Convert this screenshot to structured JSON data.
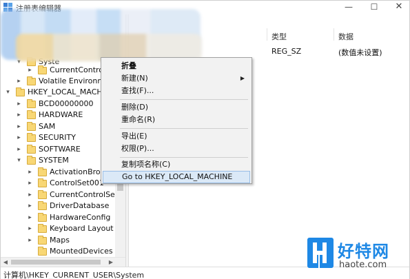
{
  "window": {
    "title": "注册表编辑器",
    "controls": {
      "minimize": "—",
      "maximize": "☐",
      "close": "✕"
    }
  },
  "tree": {
    "items": [
      {
        "label": "Syste",
        "chevron": "▾"
      },
      {
        "label": "CurrentControlS",
        "chevron": "▸"
      },
      {
        "label": "Volatile Environme",
        "chevron": "▸"
      },
      {
        "label": "HKEY_LOCAL_MACHIN",
        "chevron": "▾"
      },
      {
        "label": "BCD00000000",
        "chevron": "▸"
      },
      {
        "label": "HARDWARE",
        "chevron": "▸"
      },
      {
        "label": "SAM",
        "chevron": "▸"
      },
      {
        "label": "SECURITY",
        "chevron": "▸"
      },
      {
        "label": "SOFTWARE",
        "chevron": "▸"
      },
      {
        "label": "SYSTEM",
        "chevron": "▾"
      },
      {
        "label": "ActivationBroke",
        "chevron": "▸"
      },
      {
        "label": "ControlSet001",
        "chevron": "▸"
      },
      {
        "label": "CurrentControlSet",
        "chevron": "▸"
      },
      {
        "label": "DriverDatabase",
        "chevron": "▸"
      },
      {
        "label": "HardwareConfig",
        "chevron": "▸"
      },
      {
        "label": "Keyboard Layout",
        "chevron": "▸"
      },
      {
        "label": "Maps",
        "chevron": "▸"
      },
      {
        "label": "MountedDevices",
        "chevron": ""
      }
    ]
  },
  "list": {
    "columns": {
      "type": "类型",
      "data": "数据"
    },
    "rows": [
      {
        "type": "REG_SZ",
        "data": "(数值未设置)"
      }
    ]
  },
  "context_menu": {
    "items": {
      "collapse": "折叠",
      "new": "新建(N)",
      "find": "查找(F)...",
      "delete": "删除(D)",
      "rename": "重命名(R)",
      "export": "导出(E)",
      "permissions": "权限(P)...",
      "copy_key_name": "复制项名称(C)",
      "goto": "Go to HKEY_LOCAL_MACHINE"
    },
    "submenu_arrow": "▶"
  },
  "scrollbars": {
    "up": "▲",
    "down": "▼",
    "left": "◀",
    "right": "▶"
  },
  "status": {
    "path": "计算机\\HKEY_CURRENT_USER\\System"
  },
  "watermark": {
    "name": "好特网",
    "domain": "haote.com"
  },
  "colors": {
    "folder": "#f8d775",
    "menu_hover": "#dbe9f7",
    "watermark": "#1e88e5"
  }
}
